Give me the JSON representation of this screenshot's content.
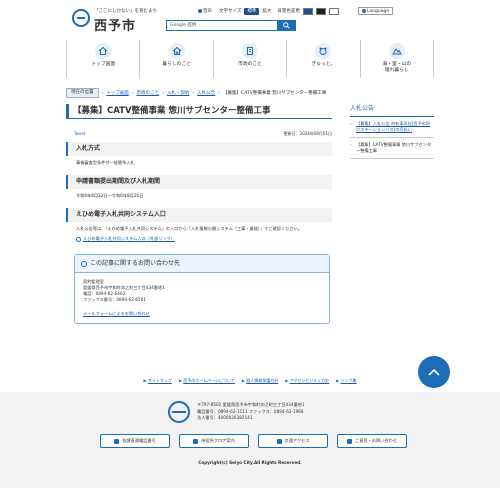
{
  "header": {
    "tagline": "「ここにしかない」を育むまち",
    "site_name": "西予市",
    "util": {
      "voice": "音声",
      "text_size_label": "文字サイズ",
      "standard": "標準",
      "enlarge": "拡大",
      "bg_color_label": "背景色変更",
      "language": "Language"
    },
    "search_placeholder": "Google 提供"
  },
  "gnav": [
    {
      "label": "トップ画面",
      "icon": "home-icon"
    },
    {
      "label": "暮らしのこと",
      "icon": "house-icon"
    },
    {
      "label": "市政のこと",
      "icon": "building-icon"
    },
    {
      "label": "ぎゅっと。",
      "icon": "bear-icon"
    },
    {
      "label": "海・里・山の\n憧れ暮らし",
      "icon": "mountain-icon"
    }
  ],
  "breadcrumb": {
    "here_label": "現在の位置",
    "items": [
      "トップ画面",
      "市政のこと",
      "入札・契約",
      "入札公告"
    ],
    "current": "【募集】CATV整備事業 惣川サブセンター整備工事"
  },
  "main": {
    "title": "【募集】CATV整備事業 惣川サブセンター整備工事",
    "tweet": "Tweet",
    "updated": "更新日：2024年08月01日",
    "sections": [
      {
        "heading": "入札方式",
        "text": "事後審査型条件付一般競争入札"
      },
      {
        "heading": "申請書類提出期間及び入札期間",
        "text": "令和6年8月22日～令和6年8月26日"
      },
      {
        "heading": "えひめ電子入札共同システム入口",
        "text": "入札公告等は、「えひめ電子入札共同システム」の入口から「入札情報公開システム（工事・業務）」でご確認ください。"
      }
    ],
    "ext_link": "えひめ電子入札共同システム入口（外部リンク）",
    "contact": {
      "title": "この記事に関するお問い合わせ先",
      "lines": [
        "契約監理室",
        "愛媛県西予市宇和町卯之町三丁目434番地1",
        "電話：0894-62-6402",
        "ファックス番号：0894-62-6501"
      ],
      "form_link": "メールフォームによるお問い合わせ"
    }
  },
  "sidebar": {
    "title": "入札公告",
    "items": [
      "【募集】入札公告 市有車両(旧西予市防災ステーションバス)の売払い",
      "【募集】CATV整備事業 惣川サブセンター整備工事"
    ]
  },
  "footer": {
    "links": [
      "サイトマップ",
      "西予市ホームページについて",
      "個人情報保護方針",
      "アクセシビリティ方針",
      "リンク集"
    ],
    "address": "〒797-8501 愛媛県西予市宇和町卯之町三丁目434番地1",
    "phone": "電話番号：0894-62-1111 ファックス：0894-62-1968",
    "corp": "法人番号：4000020382141",
    "buttons": [
      "各課直通電話番号",
      "市役所フロア案内",
      "交通アクセス",
      "ご意見・お問い合わせ"
    ],
    "copyright": "Copyright(c) Seiyo City.All Rights Reserved."
  },
  "colors": {
    "accent": "#1d6cb8",
    "nav_bg": "#1f4e8c"
  }
}
